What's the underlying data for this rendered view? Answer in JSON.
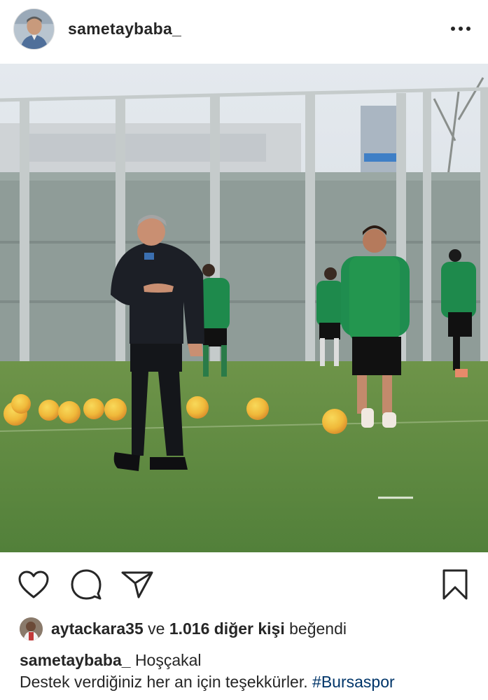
{
  "post": {
    "author": "sametaybaba_",
    "more_icon": "more-horizontal-icon"
  },
  "actions": {
    "like_icon": "heart-icon",
    "comment_icon": "comment-icon",
    "share_icon": "paper-plane-icon",
    "save_icon": "bookmark-icon"
  },
  "likes": {
    "user": "aytackara35",
    "connector": "ve",
    "count": "1.016 diğer kişi",
    "suffix": "beğendi"
  },
  "caption": {
    "author": "sametaybaba_",
    "line1": "Hoşçakal",
    "line2": "Destek verdiğiniz her an için teşekkürler.",
    "hashtag": "#Bursaspor"
  },
  "colors": {
    "text": "#262626",
    "hashtag": "#003569",
    "pitch": "#5f8a3c",
    "kit_green": "#1f8a4c"
  }
}
